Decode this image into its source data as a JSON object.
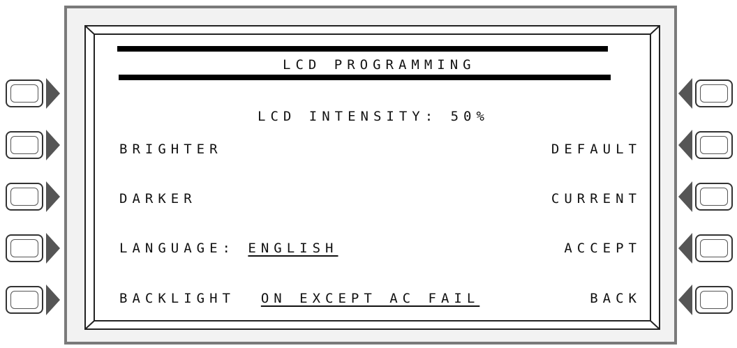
{
  "screen": {
    "title": "LCD PROGRAMMING",
    "intensity_label": "LCD INTENSITY:",
    "intensity_value": "50%"
  },
  "left_options": {
    "brighter": "BRIGHTER",
    "darker": "DARKER",
    "language_label": "LANGUAGE:",
    "language_value": "ENGLISH",
    "backlight_label": "BACKLIGHT",
    "backlight_value": "ON EXCEPT AC FAIL"
  },
  "right_options": {
    "default": "DEFAULT",
    "current": "CURRENT",
    "accept": "ACCEPT",
    "back": "BACK"
  }
}
